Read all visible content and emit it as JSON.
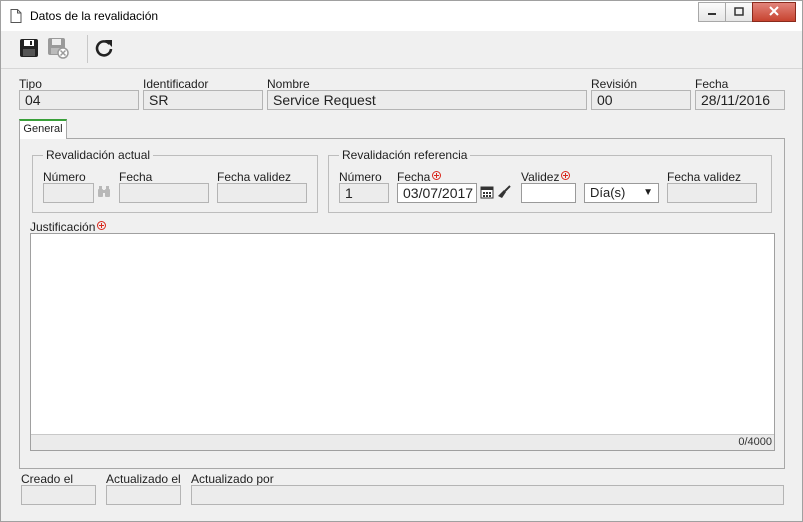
{
  "window": {
    "title": "Datos de la revalidación"
  },
  "header": {
    "tipo": {
      "label": "Tipo",
      "value": "04"
    },
    "identificador": {
      "label": "Identificador",
      "value": "SR"
    },
    "nombre": {
      "label": "Nombre",
      "value": "Service Request"
    },
    "revision": {
      "label": "Revisión",
      "value": "00"
    },
    "fecha": {
      "label": "Fecha",
      "value": "28/11/2016"
    }
  },
  "tabs": [
    {
      "label": "General"
    }
  ],
  "actual": {
    "title": "Revalidación actual",
    "numero_label": "Número",
    "fecha_label": "Fecha",
    "fecha_validez_label": "Fecha validez"
  },
  "referencia": {
    "title": "Revalidación referencia",
    "numero_label": "Número",
    "numero_value": "1",
    "fecha_label": "Fecha",
    "fecha_value": "03/07/2017",
    "validez_label": "Validez",
    "validez_value": "",
    "unit_value": "Día(s)",
    "fecha_validez_label": "Fecha validez"
  },
  "justificacion": {
    "label": "Justificación",
    "counter": "0/4000"
  },
  "footer": {
    "creado_label": "Creado el",
    "actualizado_label": "Actualizado el",
    "actualizado_por_label": "Actualizado por"
  },
  "colors": {
    "required": "#d9281d",
    "tab_accent": "#3aa03a",
    "close_button": "#c7432f"
  },
  "icons": [
    "document-icon",
    "minimize-icon",
    "maximize-icon",
    "close-icon",
    "save-icon",
    "save-close-icon",
    "refresh-icon",
    "binoculars-icon",
    "calendar-icon",
    "eraser-icon",
    "dropdown-arrow-icon",
    "required-icon"
  ]
}
